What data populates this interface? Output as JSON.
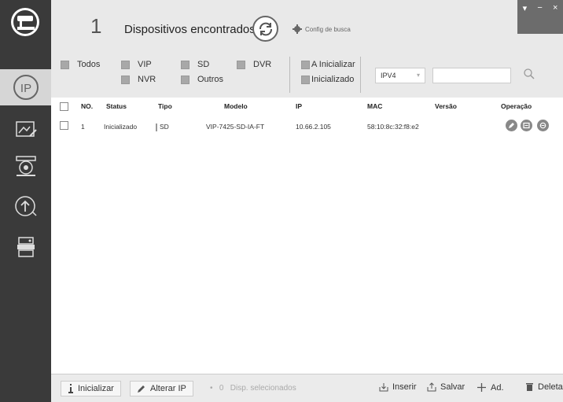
{
  "header": {
    "count": "1",
    "title": "Dispositivos encontrados",
    "config_label": "Config de busca",
    "window_controls": [
      "▾",
      "−",
      "×"
    ]
  },
  "filters": {
    "todos": "Todos",
    "vip": "VIP",
    "sd": "SD",
    "dvr": "DVR",
    "nvr": "NVR",
    "outros": "Outros",
    "a_inicializar": "A Inicializar",
    "inicializado": "Inicializado",
    "ip_version": "IPV4",
    "search_value": ""
  },
  "table": {
    "columns": [
      "NO.",
      "Status",
      "Tipo",
      "Modelo",
      "IP",
      "MAC",
      "Versão",
      "Operação"
    ],
    "rows": [
      {
        "no": "1",
        "status": "Inicializado",
        "tipo": "SD",
        "modelo": "VIP-7425-SD-IA-FT",
        "ip": "10.66.2.105",
        "mac": "58:10:8c:32:f8:e2",
        "versao": ""
      }
    ]
  },
  "footer": {
    "inicializar": "Inicializar",
    "alterar_ip": "Alterar IP",
    "selected_count": "0",
    "selected_label": "Disp. selecionados",
    "inserir": "Inserir",
    "salvar": "Salvar",
    "adicionar": "Ad.",
    "deletar": "Deletar"
  },
  "colors": {
    "sidebar": "#3a3a3a",
    "panel": "#e9e9e9",
    "active_item": "#d6d6d6"
  }
}
